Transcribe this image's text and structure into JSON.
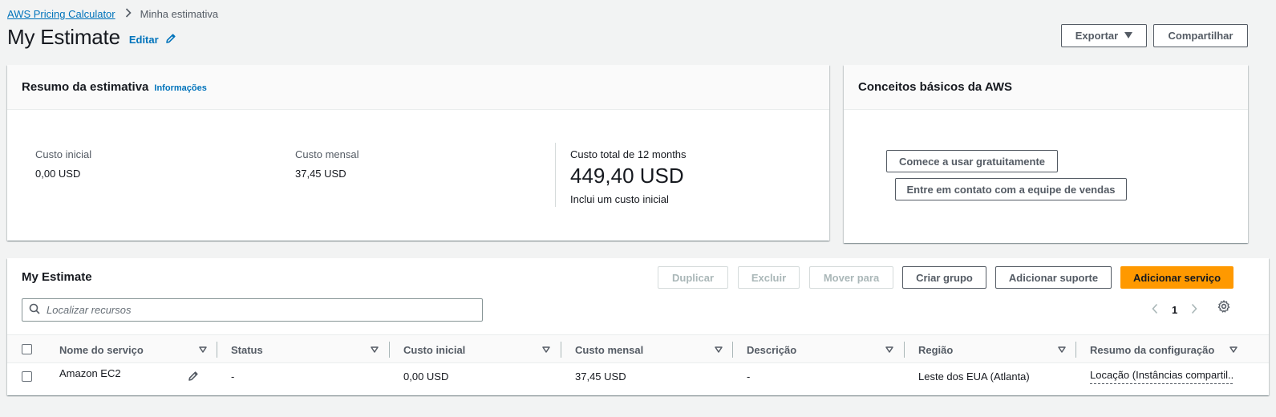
{
  "breadcrumb": {
    "root": "AWS Pricing Calculator",
    "current": "Minha estimativa"
  },
  "header": {
    "title": "My Estimate",
    "edit_label": "Editar",
    "export_label": "Exportar",
    "share_label": "Compartilhar"
  },
  "summary": {
    "title": "Resumo da estimativa",
    "info_link": "Informações",
    "upfront_label": "Custo inicial",
    "upfront_value": "0,00 USD",
    "monthly_label": "Custo mensal",
    "monthly_value": "37,45 USD",
    "total_label": "Custo total de 12 months",
    "total_value": "449,40 USD",
    "total_note": "Inclui um custo inicial"
  },
  "basics": {
    "title": "Conceitos básicos da AWS",
    "free_button": "Comece a usar gratuitamente",
    "sales_button": "Entre em contato com a equipe de vendas"
  },
  "estimate": {
    "title": "My Estimate",
    "duplicate": "Duplicar",
    "delete": "Excluir",
    "move_to": "Mover para",
    "create_group": "Criar grupo",
    "add_support": "Adicionar suporte",
    "add_service": "Adicionar serviço",
    "search_placeholder": "Localizar recursos",
    "page_number": "1",
    "columns": [
      "Nome do serviço",
      "Status",
      "Custo inicial",
      "Custo mensal",
      "Descrição",
      "Região",
      "Resumo da configuração"
    ],
    "rows": [
      {
        "service": "Amazon EC2",
        "status": "-",
        "upfront": "0,00 USD",
        "monthly": "37,45 USD",
        "description": "-",
        "region": "Leste dos EUA (Atlanta)",
        "config": "Locação (Instâncias compartil..."
      }
    ]
  },
  "colors": {
    "link": "#0073bb",
    "primary": "#ff9900",
    "background": "#f2f3f3"
  }
}
